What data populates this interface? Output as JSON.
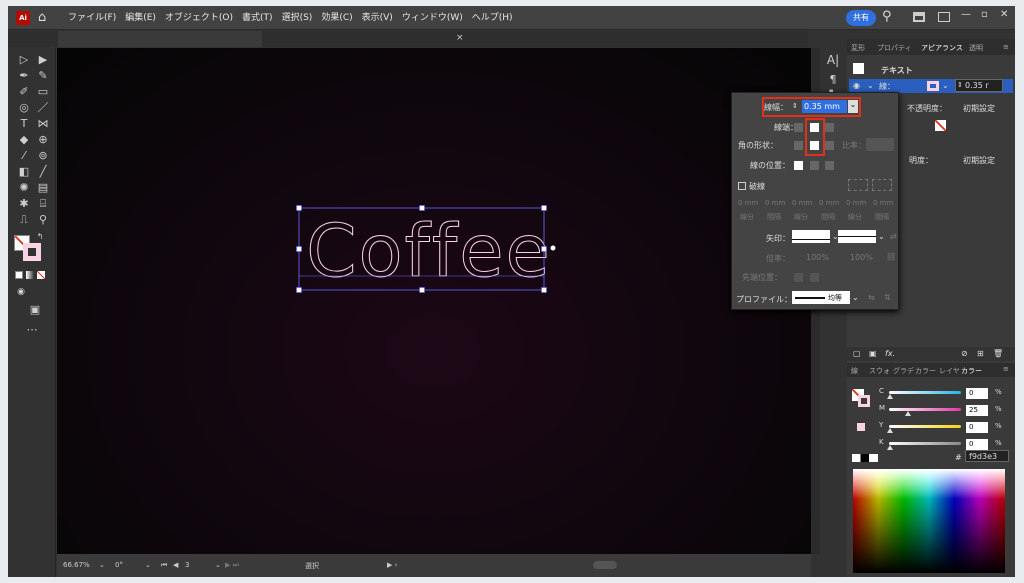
{
  "menubar": {
    "logo": "Ai",
    "items": [
      "ファイル(F)",
      "編集(E)",
      "オブジェクト(O)",
      "書式(T)",
      "選択(S)",
      "効果(C)",
      "表示(V)",
      "ウィンドウ(W)",
      "ヘルプ(H)"
    ],
    "share_label": "共有",
    "close_tab": "×"
  },
  "artwork": {
    "text": "Coffee",
    "stroke_color": "#f9d3e3"
  },
  "status_bar": {
    "zoom": "66.67%",
    "rotation": "0°",
    "artboard": "3",
    "mode": "選択"
  },
  "right_panel": {
    "tabs": [
      "変形",
      "プロパティ",
      "アピアランス",
      "透明"
    ],
    "active_tab": "アピアランス",
    "object_label": "テキスト",
    "stroke_label": "線：",
    "stroke_value": "0.35 r",
    "opacity_label": "不透明度：",
    "opacity_value": "初期設定",
    "opacity_label2": "明度：",
    "opacity_value2": "初期設定"
  },
  "stroke_popup": {
    "weight_label": "線幅：",
    "weight_value": "0.35 mm",
    "cap_label": "線端：",
    "corner_label": "角の形状：",
    "limit_label": "比率：",
    "align_label": "線の位置：",
    "dashed_label": "破線",
    "dash_units": [
      "0 mm",
      "0 mm",
      "0 mm",
      "0 mm",
      "0 mm",
      "0 mm"
    ],
    "dash_labels": [
      "線分",
      "間隔",
      "線分",
      "間隔",
      "線分",
      "間隔"
    ],
    "arrow_label": "矢印：",
    "scale_label": "倍率：",
    "scale_values": [
      "100%",
      "100%"
    ],
    "tip_label": "先端位置：",
    "profile_label": "プロファイル：",
    "profile_value": "均等"
  },
  "color_panel": {
    "tabs": [
      "線",
      "スウォ",
      "グラデ",
      "カラー",
      "レイヤ",
      "カラー"
    ],
    "channels": [
      {
        "label": "C",
        "value": "0",
        "unit": "%",
        "level": 0,
        "color": "#28b4e6"
      },
      {
        "label": "M",
        "value": "25",
        "unit": "%",
        "level": 25,
        "color": "#e236a4"
      },
      {
        "label": "Y",
        "value": "0",
        "unit": "%",
        "level": 0,
        "color": "#f2d11a"
      },
      {
        "label": "K",
        "value": "0",
        "unit": "%",
        "level": 0,
        "color": "#888888"
      }
    ],
    "hex_prefix": "#",
    "hex_value": "f9d3e3"
  }
}
